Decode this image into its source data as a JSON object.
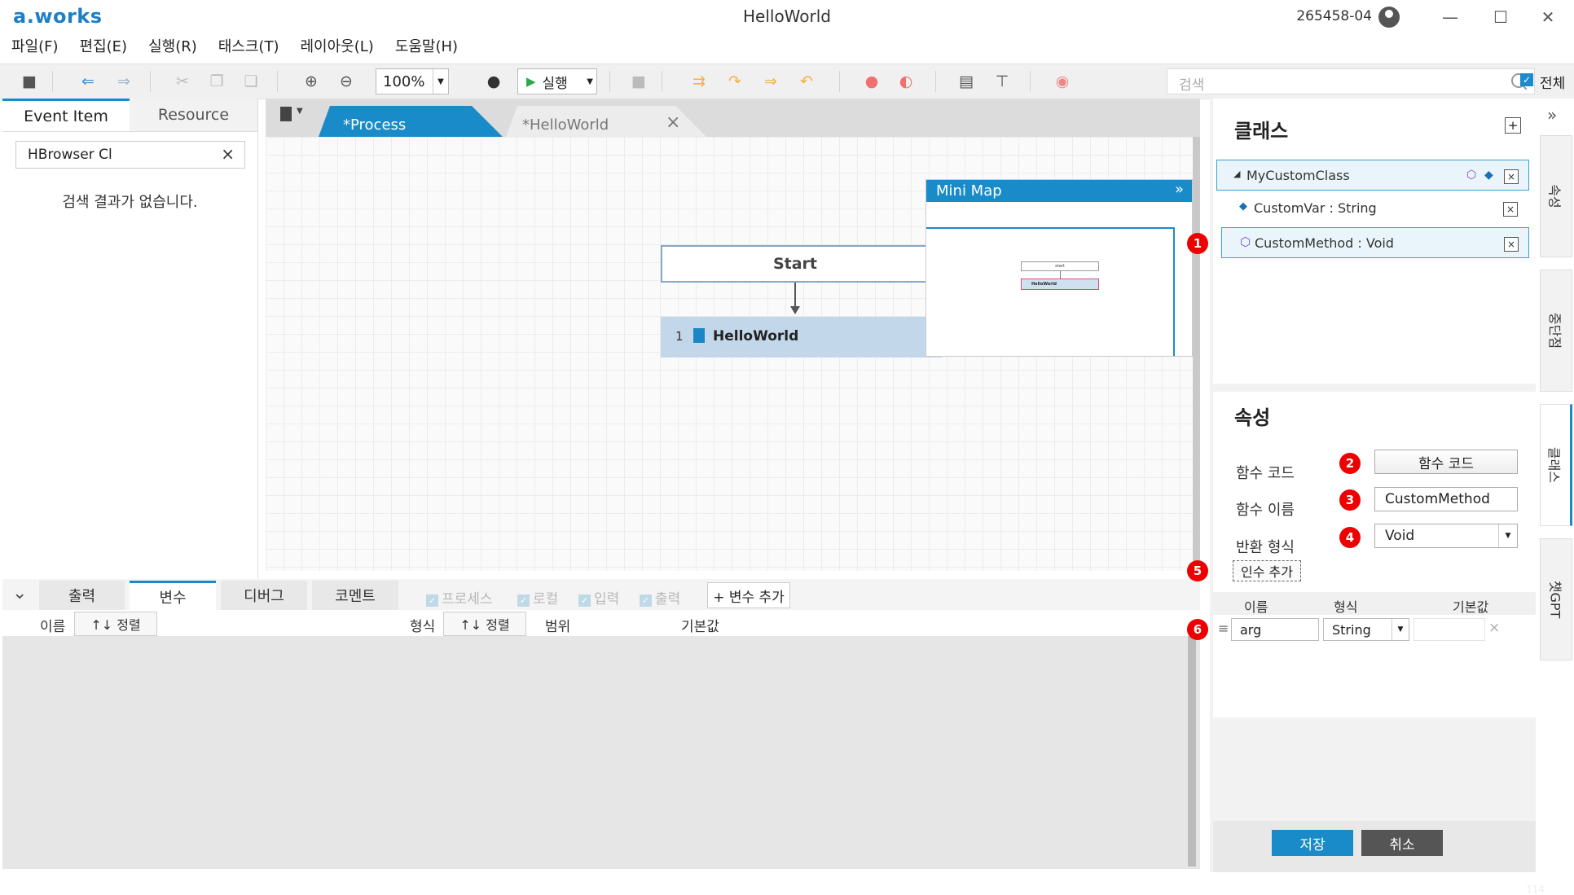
{
  "app": {
    "logo": "a.works",
    "title": "HelloWorld",
    "user_id": "265458-04",
    "window_controls": {
      "minimize": "—",
      "maximize": "☐",
      "close": "✕"
    }
  },
  "menu": [
    "파일(F)",
    "편집(E)",
    "실행(R)",
    "태스크(T)",
    "레이아웃(L)",
    "도움말(H)"
  ],
  "toolbar": {
    "zoom": "100%",
    "run_label": "실행",
    "search_placeholder": "검색",
    "all_label": "전체"
  },
  "left_panel": {
    "tabs": [
      "Event Item",
      "Resource"
    ],
    "search_value": "HBrowser Cl",
    "empty_message": "검색 결과가 없습니다."
  },
  "designer": {
    "tabs": [
      "*Process",
      "*HelloWorld"
    ],
    "start_node": "Start",
    "activity": {
      "index": "1",
      "label": "HelloWorld"
    },
    "minimap": {
      "title": "Mini Map",
      "start": "start",
      "activity": "HelloWorld"
    }
  },
  "bottom": {
    "tabs": [
      "출력",
      "변수",
      "디버그",
      "코멘트"
    ],
    "active_tab": "변수",
    "filters": [
      "프로세스",
      "로컬",
      "입력",
      "출력"
    ],
    "add_variable": "+ 변수 추가",
    "columns": {
      "name": "이름",
      "type": "형식",
      "scope": "범위",
      "default": "기본값"
    },
    "sort_label": "↑↓ 정렬"
  },
  "class_panel": {
    "title": "클래스",
    "class_name": "MyCustomClass",
    "members": [
      {
        "label": "CustomVar : String",
        "icon": "variable-icon"
      },
      {
        "label": "CustomMethod : Void",
        "icon": "method-cube-icon"
      }
    ]
  },
  "properties": {
    "title": "속성",
    "func_code_label": "함수 코드",
    "func_code_button": "함수 코드",
    "func_name_label": "함수 이름",
    "func_name_value": "CustomMethod",
    "return_type_label": "반환 형식",
    "return_type_value": "Void",
    "add_arg_button": "인수 추가",
    "arg_columns": {
      "name": "이름",
      "type": "형식",
      "default": "기본값"
    },
    "arg_row": {
      "name": "arg",
      "type": "String",
      "default": ""
    }
  },
  "footer": {
    "save": "저장",
    "cancel": "취소"
  },
  "side_tabs": [
    "속성",
    "중단점",
    "클래스",
    "챗GPT"
  ],
  "badges": [
    "1",
    "2",
    "3",
    "4",
    "5",
    "6"
  ],
  "page_number": "114",
  "colors": {
    "accent": "#1a8bc9",
    "badge": "#e00000",
    "activity_fill": "#c3d7ea"
  }
}
